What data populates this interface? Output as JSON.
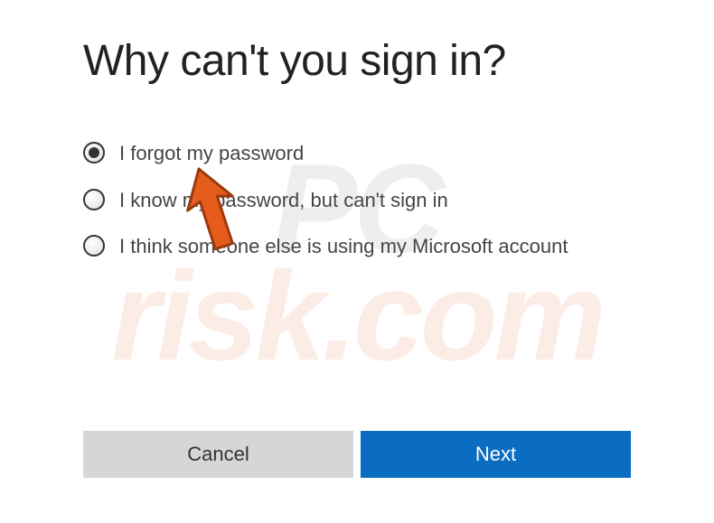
{
  "title": "Why can't you sign in?",
  "options": [
    {
      "label": "I forgot my password",
      "selected": true
    },
    {
      "label": "I know my password, but can't sign in",
      "selected": false
    },
    {
      "label": "I think someone else is using my Microsoft account",
      "selected": false
    }
  ],
  "buttons": {
    "cancel": "Cancel",
    "next": "Next"
  },
  "watermark": {
    "line1": "PC",
    "line2": "risk.com"
  },
  "annotation": {
    "arrow_color": "#e65c1c",
    "arrow_stroke": "#9a3b0f"
  }
}
